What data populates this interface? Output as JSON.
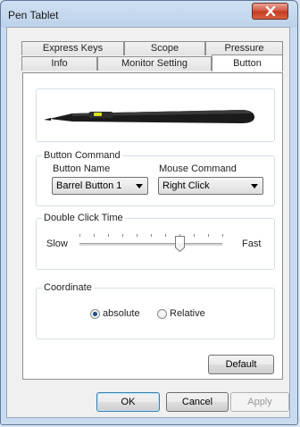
{
  "window": {
    "title": "Pen Tablet"
  },
  "tabs": {
    "back_row": [
      {
        "label": "Express Keys"
      },
      {
        "label": "Scope"
      },
      {
        "label": "Pressure"
      }
    ],
    "front_row": [
      {
        "label": "Info"
      },
      {
        "label": "Monitor Setting"
      },
      {
        "label": "Button",
        "active": true
      }
    ]
  },
  "button_command": {
    "group_label": "Button Command",
    "button_name_label": "Button Name",
    "button_name_value": "Barrel Button 1",
    "mouse_command_label": "Mouse Command",
    "mouse_command_value": "Right Click"
  },
  "double_click": {
    "group_label": "Double Click Time",
    "slow_label": "Slow",
    "fast_label": "Fast",
    "level": 0.7
  },
  "coordinate": {
    "group_label": "Coordinate",
    "options": [
      {
        "label": "absolute",
        "checked": true
      },
      {
        "label": "Relative",
        "checked": false
      }
    ]
  },
  "buttons": {
    "default": "Default",
    "ok": "OK",
    "cancel": "Cancel",
    "apply": "Apply"
  },
  "icons": {
    "close": "close-icon",
    "pen": "pen-illustration",
    "slider_thumb": "slider-thumb"
  },
  "colors": {
    "pen_accent": "#d6e11a"
  }
}
